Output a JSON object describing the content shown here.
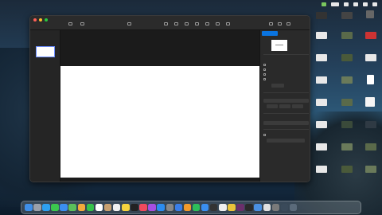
{
  "menubar": {
    "icons": [
      "drive-icon",
      "battery-icon",
      "wifi-icon",
      "search-icon",
      "control-center-icon",
      "siri-icon"
    ]
  },
  "window": {
    "title": "",
    "traffic_lights": [
      "close",
      "minimize",
      "zoom"
    ]
  },
  "toolbar": {
    "buttons": [
      {
        "name": "view",
        "icon": "sidebar-icon"
      },
      {
        "name": "zoom",
        "icon": "zoom-icon"
      },
      {
        "name": "play",
        "icon": "play-icon"
      },
      {
        "name": "table",
        "icon": "table-icon"
      },
      {
        "name": "chart",
        "icon": "chart-icon"
      },
      {
        "name": "text",
        "icon": "text-icon"
      },
      {
        "name": "shape",
        "icon": "shape-icon"
      },
      {
        "name": "media",
        "icon": "media-icon"
      },
      {
        "name": "comment",
        "icon": "comment-icon"
      },
      {
        "name": "collaborate",
        "icon": "collaborate-icon"
      },
      {
        "name": "format",
        "icon": "format-icon"
      },
      {
        "name": "animate",
        "icon": "animate-icon"
      },
      {
        "name": "document",
        "icon": "document-icon"
      }
    ]
  },
  "inspector": {
    "tabs": [
      "",
      "",
      ""
    ],
    "active_tab": 0,
    "accent": "#0a74e0"
  },
  "desktop": {
    "file_icons": [
      {
        "color": "#e8e8e8"
      },
      {
        "color": "#5a6a4a"
      },
      {
        "color": "#e8e8e8"
      },
      {
        "color": "#cc3333"
      },
      {
        "color": "#e8e8e8"
      },
      {
        "color": "#4a5a3a"
      },
      {
        "color": "#e8e8e8"
      },
      {
        "color": "#6a7a5a"
      },
      {
        "color": "#e8e8e8"
      },
      {
        "color": "#ffffff"
      },
      {
        "color": "#e8e8e8"
      },
      {
        "color": "#5a6a4a"
      },
      {
        "color": "#e8e8e8"
      },
      {
        "color": "#3a4a3a"
      },
      {
        "color": "#e8e8e8"
      },
      {
        "color": "#6a7a5a"
      },
      {
        "color": "#e8e8e8"
      },
      {
        "color": "#ffffff"
      }
    ]
  },
  "dock": {
    "apps": [
      {
        "name": "finder",
        "color": "#3f8fe8"
      },
      {
        "name": "launchpad",
        "color": "#9aa0aa"
      },
      {
        "name": "safari",
        "color": "#2ea0f0"
      },
      {
        "name": "messages",
        "color": "#3cc84e"
      },
      {
        "name": "mail",
        "color": "#3b8ef0"
      },
      {
        "name": "maps",
        "color": "#5bbf5b"
      },
      {
        "name": "photos",
        "color": "#f2a93b"
      },
      {
        "name": "facetime",
        "color": "#35c24a"
      },
      {
        "name": "calendar",
        "color": "#ffffff"
      },
      {
        "name": "contacts",
        "color": "#c8a070"
      },
      {
        "name": "reminders",
        "color": "#f0f0f0"
      },
      {
        "name": "notes",
        "color": "#f5d33e"
      },
      {
        "name": "tv",
        "color": "#222222"
      },
      {
        "name": "music",
        "color": "#f04a5d"
      },
      {
        "name": "podcasts",
        "color": "#a64fe0"
      },
      {
        "name": "app-store",
        "color": "#2b8cf0"
      },
      {
        "name": "system-preferences",
        "color": "#888888"
      },
      {
        "name": "keynote",
        "color": "#3a7ee8"
      },
      {
        "name": "pages",
        "color": "#f39a2b"
      },
      {
        "name": "numbers",
        "color": "#2dbf5a"
      },
      {
        "name": "xcode",
        "color": "#3a8ff0"
      },
      {
        "name": "terminal",
        "color": "#333333"
      },
      {
        "name": "activity-monitor",
        "color": "#eeeeee"
      },
      {
        "name": "chrome",
        "color": "#e9c23a"
      },
      {
        "name": "slack",
        "color": "#6b2f6b"
      },
      {
        "name": "app-generic-1",
        "color": "#2a2a2a"
      },
      {
        "name": "app-generic-2",
        "color": "#4a90e2"
      },
      {
        "name": "app-generic-3",
        "color": "#e0e0e0"
      },
      {
        "name": "app-generic-4",
        "color": "#7a7a7a"
      },
      {
        "name": "downloads",
        "color": "#3a4a5a"
      },
      {
        "name": "trash",
        "color": "#5a6a7a"
      }
    ]
  }
}
